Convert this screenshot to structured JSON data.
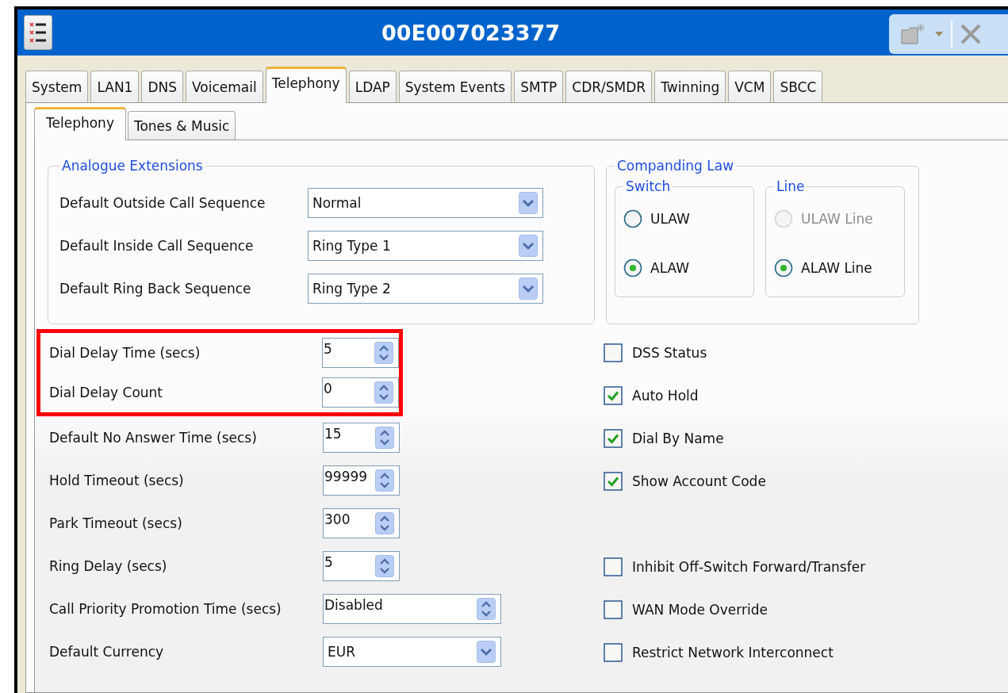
{
  "window": {
    "title": "00E007023377"
  },
  "tabs": [
    {
      "label": "System",
      "selected": false
    },
    {
      "label": "LAN1",
      "selected": false
    },
    {
      "label": "DNS",
      "selected": false
    },
    {
      "label": "Voicemail",
      "selected": false
    },
    {
      "label": "Telephony",
      "selected": true
    },
    {
      "label": "LDAP",
      "selected": false
    },
    {
      "label": "System Events",
      "selected": false
    },
    {
      "label": "SMTP",
      "selected": false
    },
    {
      "label": "CDR/SMDR",
      "selected": false
    },
    {
      "label": "Twinning",
      "selected": false
    },
    {
      "label": "VCM",
      "selected": false
    },
    {
      "label": "SBCC",
      "selected": false
    }
  ],
  "subtabs": [
    {
      "label": "Telephony",
      "selected": true
    },
    {
      "label": "Tones & Music",
      "selected": false
    }
  ],
  "analogue_extensions": {
    "title": "Analogue Extensions",
    "fields": [
      {
        "label": "Default Outside Call Sequence",
        "value": "Normal"
      },
      {
        "label": "Default Inside Call Sequence",
        "value": "Ring Type 1"
      },
      {
        "label": "Default Ring Back Sequence",
        "value": "Ring Type 2"
      }
    ]
  },
  "companding_law": {
    "title": "Companding Law",
    "groups": [
      {
        "title": "Switch",
        "options": [
          {
            "label": "ULAW",
            "selected": false,
            "disabled": false
          },
          {
            "label": "ALAW",
            "selected": true,
            "disabled": false
          }
        ]
      },
      {
        "title": "Line",
        "options": [
          {
            "label": "ULAW Line",
            "selected": false,
            "disabled": true
          },
          {
            "label": "ALAW Line",
            "selected": true,
            "disabled": false
          }
        ]
      }
    ]
  },
  "settings": [
    {
      "label": "Dial Delay Time (secs)",
      "value": "5",
      "kind": "spin",
      "highlighted": true
    },
    {
      "label": "Dial Delay Count",
      "value": "0",
      "kind": "spin",
      "highlighted": true
    },
    {
      "label": "Default No Answer Time (secs)",
      "value": "15",
      "kind": "spin",
      "highlighted": false
    },
    {
      "label": "Hold Timeout (secs)",
      "value": "99999",
      "kind": "spin",
      "highlighted": false
    },
    {
      "label": "Park Timeout (secs)",
      "value": "300",
      "kind": "spin",
      "highlighted": false
    },
    {
      "label": "Ring Delay (secs)",
      "value": "5",
      "kind": "spin",
      "highlighted": false
    },
    {
      "label": "Call Priority Promotion Time (secs)",
      "value": "Disabled",
      "kind": "wide-spin",
      "highlighted": false
    },
    {
      "label": "Default Currency",
      "value": "EUR",
      "kind": "dropdown",
      "highlighted": false
    }
  ],
  "options": [
    {
      "label": "DSS Status",
      "checked": false
    },
    {
      "label": "Auto Hold",
      "checked": true
    },
    {
      "label": "Dial By Name",
      "checked": true
    },
    {
      "label": "Show Account Code",
      "checked": true
    },
    {
      "label": "Inhibit Off-Switch Forward/Transfer",
      "checked": false
    },
    {
      "label": "WAN Mode Override",
      "checked": false
    },
    {
      "label": "Restrict Network Interconnect",
      "checked": false
    }
  ]
}
